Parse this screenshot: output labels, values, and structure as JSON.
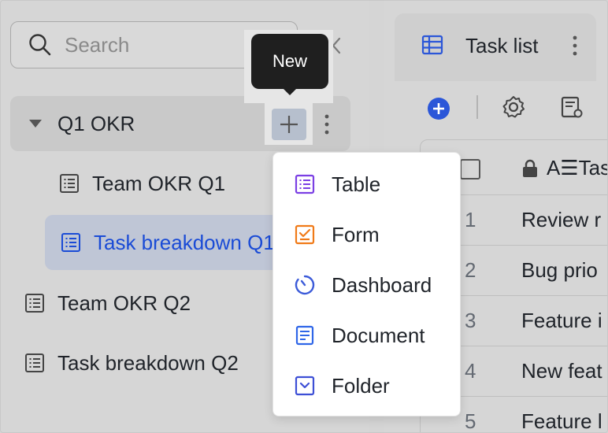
{
  "sidebar": {
    "search_placeholder": "Search",
    "items": [
      {
        "label": "Q1 OKR"
      },
      {
        "label": "Team OKR Q1"
      },
      {
        "label": "Task breakdown Q1"
      },
      {
        "label": "Team OKR Q2"
      },
      {
        "label": "Task breakdown Q2"
      }
    ]
  },
  "tooltip": {
    "text": "New"
  },
  "menu": {
    "items": [
      {
        "label": "Table",
        "icon": "table-icon",
        "color": "#7b3fe4"
      },
      {
        "label": "Form",
        "icon": "form-icon",
        "color": "#f07a18"
      },
      {
        "label": "Dashboard",
        "icon": "dashboard-icon",
        "color": "#3c5bd9"
      },
      {
        "label": "Document",
        "icon": "document-icon",
        "color": "#2f66e8"
      },
      {
        "label": "Folder",
        "icon": "folder-icon",
        "color": "#3d4fd6"
      }
    ]
  },
  "main": {
    "tab_title": "Task list",
    "accent": "#2b56d8",
    "grid": {
      "header_text": "Tas",
      "rows": [
        {
          "num": "1",
          "value": "Review r"
        },
        {
          "num": "2",
          "value": "Bug prio"
        },
        {
          "num": "3",
          "value": "Feature i"
        },
        {
          "num": "4",
          "value": "New feat"
        },
        {
          "num": "5",
          "value": "Feature l"
        }
      ]
    }
  }
}
